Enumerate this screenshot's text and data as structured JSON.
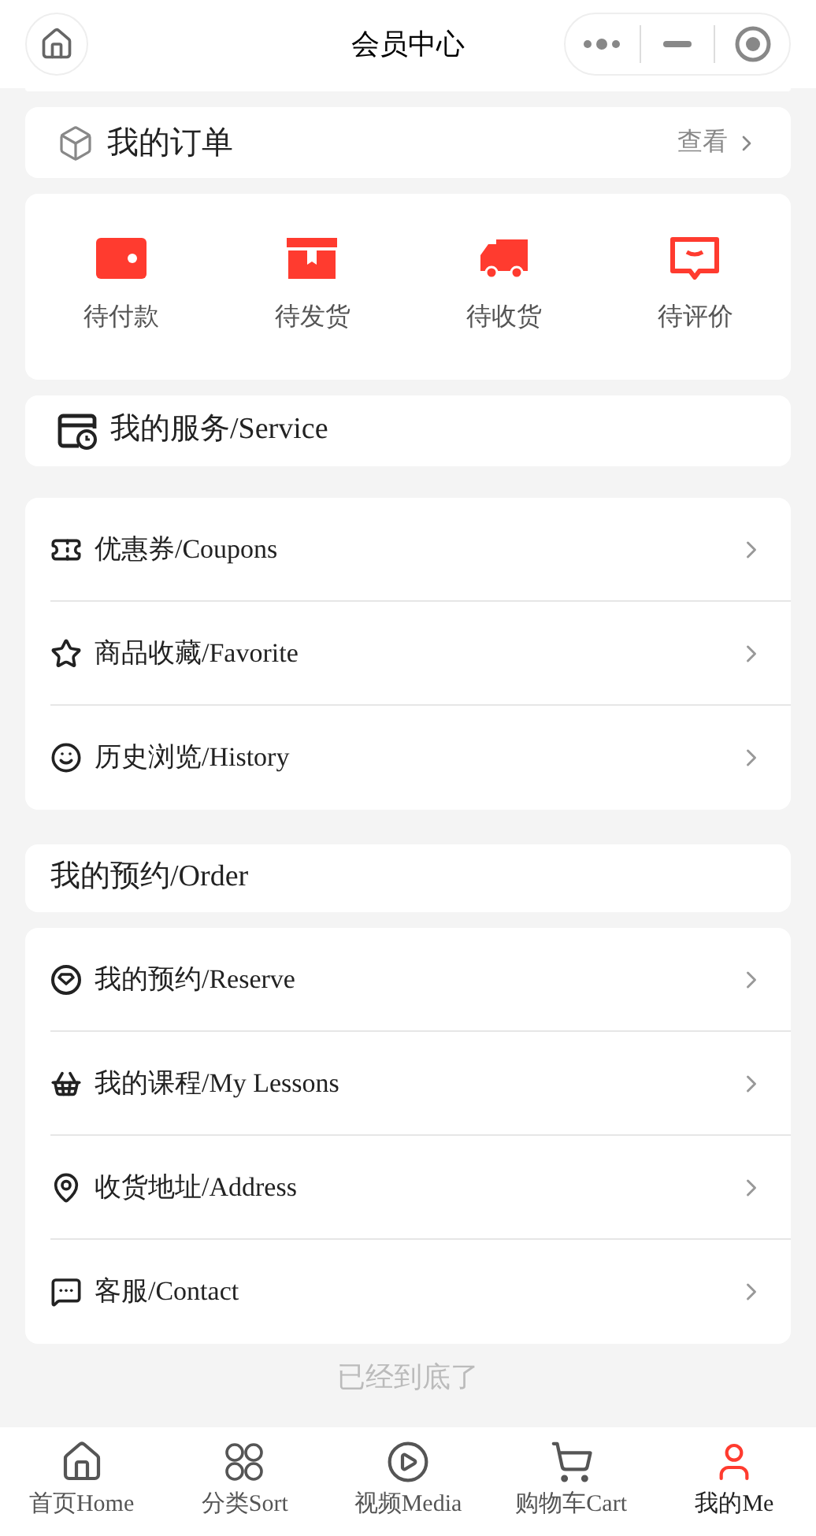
{
  "header": {
    "title": "会员中心"
  },
  "orders": {
    "title": "我的订单",
    "link": "查看",
    "statuses": [
      {
        "label": "待付款"
      },
      {
        "label": "待发货"
      },
      {
        "label": "待收货"
      },
      {
        "label": "待评价"
      }
    ]
  },
  "service": {
    "title": "我的服务/Service",
    "items": [
      {
        "label": "优惠券/Coupons"
      },
      {
        "label": "商品收藏/Favorite"
      },
      {
        "label": "历史浏览/History"
      }
    ]
  },
  "reserve": {
    "title": "我的预约/Order",
    "items": [
      {
        "label": "我的预约/Reserve"
      },
      {
        "label": "我的课程/My Lessons"
      },
      {
        "label": "收货地址/Address"
      },
      {
        "label": "客服/Contact"
      }
    ]
  },
  "footer": "已经到底了",
  "tabbar": [
    {
      "label": "首页Home",
      "selected": false
    },
    {
      "label": "分类Sort",
      "selected": false
    },
    {
      "label": "视频Media",
      "selected": false
    },
    {
      "label": "购物车Cart",
      "selected": false
    },
    {
      "label": "我的Me",
      "selected": true
    }
  ]
}
